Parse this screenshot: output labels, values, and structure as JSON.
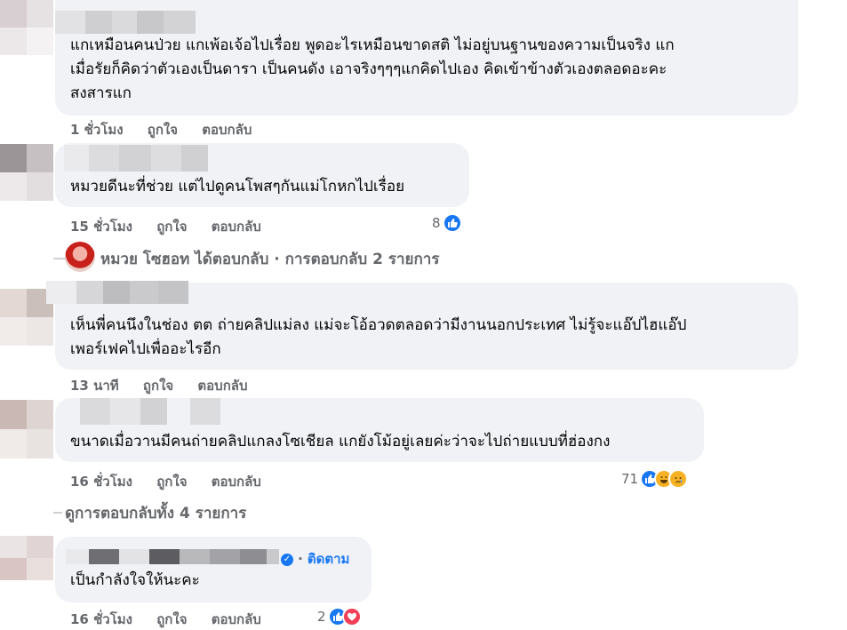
{
  "comments": [
    {
      "text_lines": [
        "แกเหมือนคนป่วย แกเพ้อเจ้อไปเรื่อย พูดอะไรเหมือนขาดสติ ไม่อยู่บนฐานของความเป็นจริง แก",
        "เมื่อรัยก็คิดว่าตัวเองเป็นดารา เป็นคนดัง เอาจริงๆๆๆแกคิดไปเอง คิดเข้าข้างตัวเองตลอดอะคะ",
        "สงสารแก"
      ],
      "time": "1 ชั่วโมง",
      "like": "ถูกใจ",
      "reply": "ตอบกลับ"
    },
    {
      "text_lines": [
        "หมวยดีนะที่ช่วย แต่ไปดูคนโพสๆกันแม่โกหกไปเรื่อย"
      ],
      "time": "15 ชั่วโมง",
      "like": "ถูกใจ",
      "reply": "ตอบกลับ",
      "reaction_count": "8"
    },
    {
      "text_lines": [
        "เห็นพี่คนนึงในช่อง ตต ถ่ายคลิปแม่ลง แม่จะโอ้อวดตลอดว่ามีงานนอกประเทศ ไม่รู้จะแอ๊ปไฮแอ๊ป",
        "เพอร์เฟคไปเพื่ออะไรอีก"
      ],
      "time": "13 นาที",
      "like": "ถูกใจ",
      "reply": "ตอบกลับ"
    },
    {
      "text_lines": [
        "ขนาดเมื่อวานมีคนถ่ายคลิปแกลงโซเชียล แกยังโม้อยู่เลยค่ะว่าจะไปถ่ายแบบที่ฮ่องกง"
      ],
      "time": "16 ชั่วโมง",
      "like": "ถูกใจ",
      "reply": "ตอบกลับ",
      "reaction_count": "71"
    },
    {
      "text_lines": [
        "เป็นกำลังใจให้นะคะ"
      ],
      "time": "16 ชั่วโมง",
      "like": "ถูกใจ",
      "reply": "ตอบกลับ",
      "reaction_count": "2",
      "follow_label": "ติดตาม"
    }
  ],
  "reply_summary": {
    "name": "หมวย โซฮอท",
    "text": " ได้ตอบกลับ · การตอบกลับ 2 รายการ"
  },
  "view_all_replies": "ดูการตอบกลับทั้ง 4 รายการ",
  "colors": {
    "bubble": "#f0f2f5",
    "meta": "#65676b",
    "accent": "#1877f2"
  }
}
